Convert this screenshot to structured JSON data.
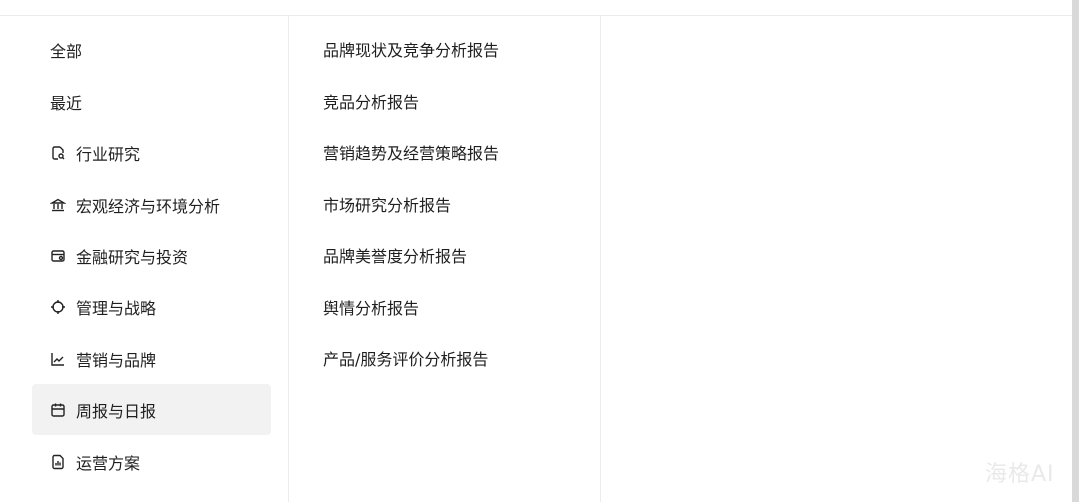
{
  "categories": [
    {
      "label": "全部",
      "icon": ""
    },
    {
      "label": "最近",
      "icon": ""
    },
    {
      "label": "行业研究",
      "icon": "document-search-icon"
    },
    {
      "label": "宏观经济与环境分析",
      "icon": "bank-icon"
    },
    {
      "label": "金融研究与投资",
      "icon": "card-icon"
    },
    {
      "label": "管理与战略",
      "icon": "target-icon"
    },
    {
      "label": "营销与品牌",
      "icon": "trend-chart-icon"
    },
    {
      "label": "周报与日报",
      "icon": "calendar-icon"
    },
    {
      "label": "运营方案",
      "icon": "report-icon"
    }
  ],
  "active_category": "周报与日报",
  "subcategories": [
    "品牌现状及竞争分析报告",
    "竞品分析报告",
    "营销趋势及经营策略报告",
    "市场研究分析报告",
    "品牌美誉度分析报告",
    "舆情分析报告",
    "产品/服务评价分析报告"
  ],
  "watermark": "海格AI",
  "colors": {
    "active_bg": "#f2f2f2",
    "divider": "#ececec",
    "text": "#1f1f1f"
  }
}
